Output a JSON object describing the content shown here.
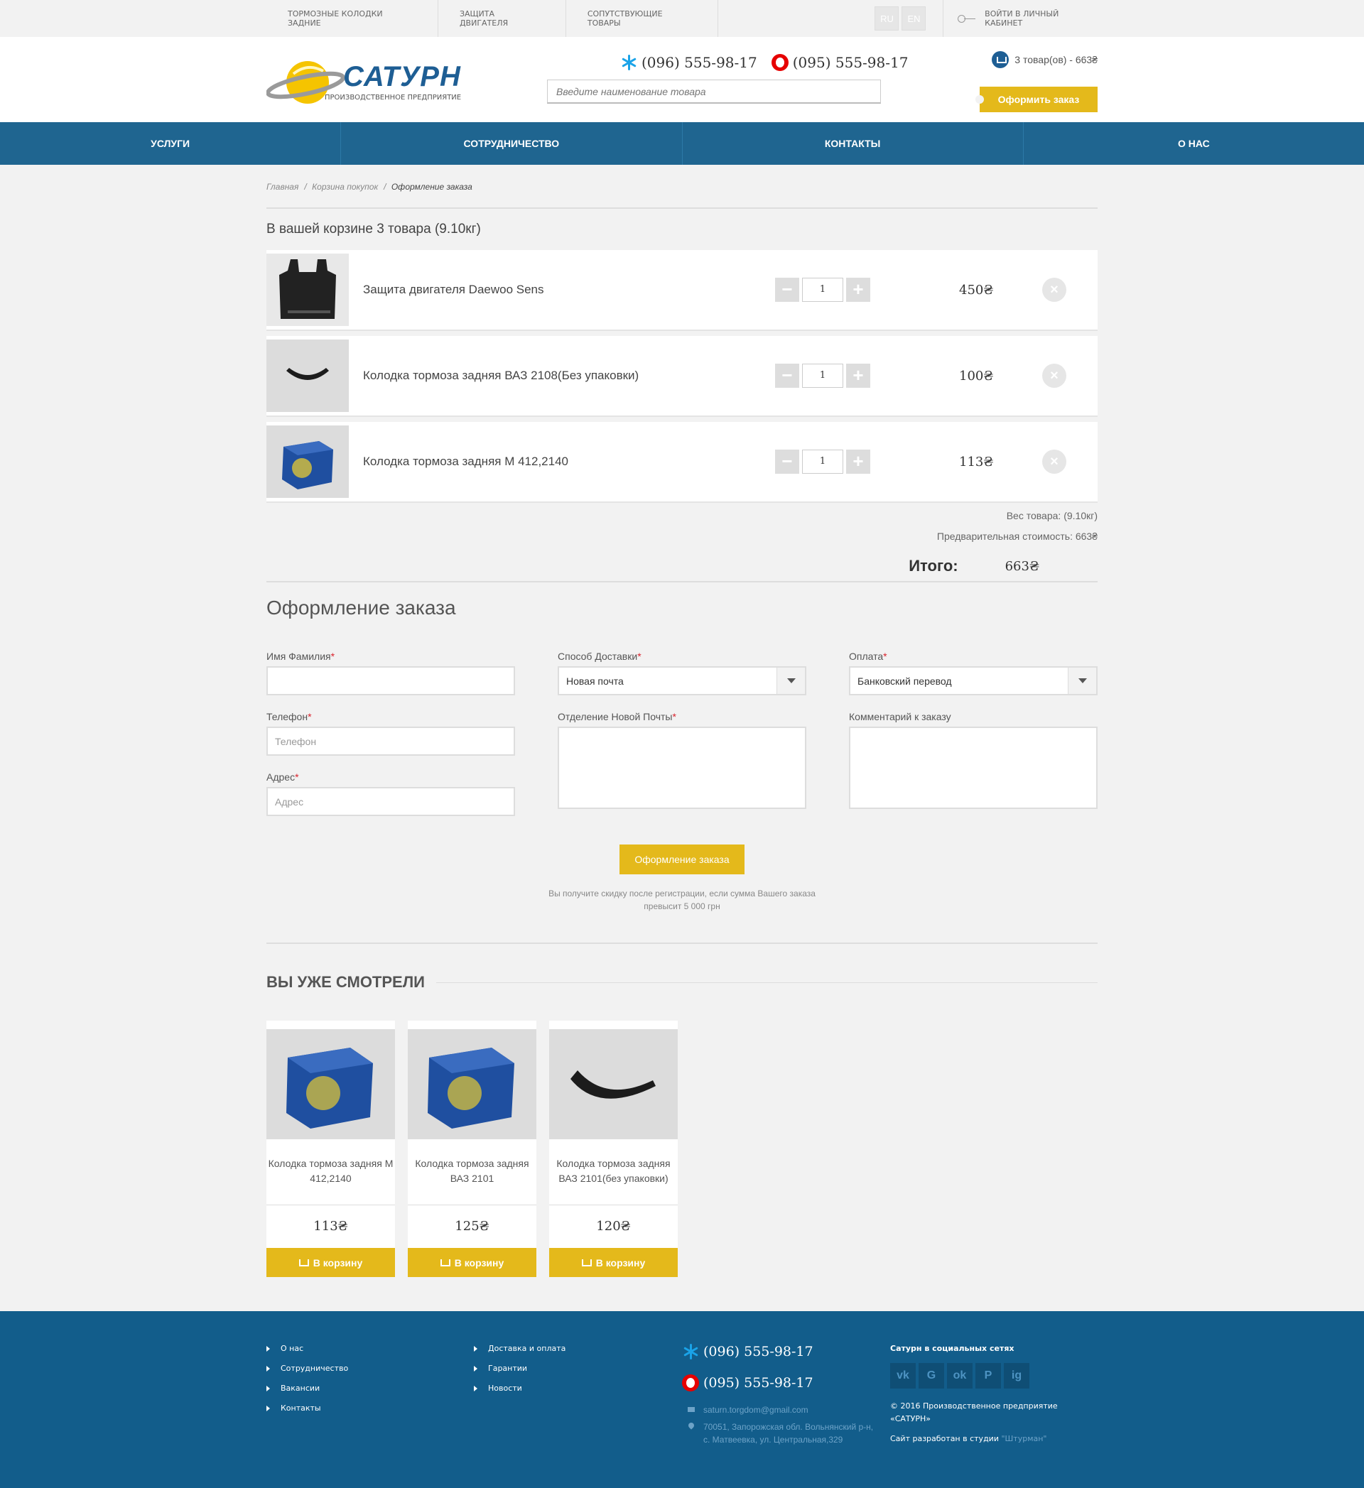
{
  "topbar": {
    "links": [
      "ТОРМОЗНЫЕ КОЛОДКИ ЗАДНИЕ",
      "ЗАЩИТА ДВИГАТЕЛЯ",
      "СОПУТСТВУЮЩИЕ ТОВАРЫ"
    ],
    "lang_ru": "RU",
    "lang_en": "EN",
    "login": "ВОЙТИ В ЛИЧНЫЙ КАБИНЕТ"
  },
  "header": {
    "logo_title": "САТУРН",
    "logo_subtitle": "ПРОИЗВОДСТВЕННОЕ ПРЕДПРИЯТИЕ",
    "phone1": "(096) 555-98-17",
    "phone2": "(095) 555-98-17",
    "search_placeholder": "Введите наименование товара",
    "cart_summary": "3 товар(ов) - 663₴",
    "checkout_label": "Оформить заказ"
  },
  "nav": [
    "УСЛУГИ",
    "СОТРУДНИЧЕСТВО",
    "КОНТАКТЫ",
    "О НАС"
  ],
  "breadcrumb": {
    "home": "Главная",
    "cart": "Корзина покупок",
    "current": "Оформление заказа",
    "sep": "/"
  },
  "cart": {
    "title": "В вашей корзине 3 товара  (9.10кг)",
    "items": [
      {
        "name": "Защита двигателя Daewoo Sens",
        "qty": "1",
        "price": "450₴"
      },
      {
        "name": "Колодка тормоза задняя ВАЗ 2108(Без упаковки)",
        "qty": "1",
        "price": "100₴"
      },
      {
        "name": "Колодка тормоза задняя М 412,2140",
        "qty": "1",
        "price": "113₴"
      }
    ],
    "weight": "Вес товара:  (9.10кг)",
    "subtotal": "Предварительная стоимость: 663₴",
    "total_label": "Итого:",
    "total_value": "663₴",
    "minus": "−",
    "plus": "+",
    "remove": "×"
  },
  "order": {
    "title": "Оформление заказа",
    "name_label": "Имя Фамилия",
    "phone_label": "Телефон",
    "phone_placeholder": "Телефон",
    "address_label": "Адрес",
    "address_placeholder": "Адрес",
    "delivery_label": "Способ Доставки",
    "delivery_value": "Новая почта",
    "branch_label": "Отделение Новой Почты",
    "payment_label": "Оплата",
    "payment_value": "Банковский перевод",
    "comment_label": "Комментарий к заказу",
    "required_mark": "*",
    "submit_label": "Оформление заказа",
    "note_line1": "Вы получите скидку после регистрации, если сумма Вашего заказа",
    "note_line2": "превысит 5 000 грн"
  },
  "viewed": {
    "title": "ВЫ УЖЕ СМОТРЕЛИ",
    "buy_label": "В корзину",
    "products": [
      {
        "name": "Колодка тормоза задняя М 412,2140",
        "price": "113₴"
      },
      {
        "name": "Колодка тормоза задняя ВАЗ 2101",
        "price": "125₴"
      },
      {
        "name": "Колодка тормоза задняя ВАЗ 2101(без упаковки)",
        "price": "120₴"
      }
    ]
  },
  "footer": {
    "col1": [
      "О нас",
      "Сотрудничество",
      "Вакансии",
      "Контакты"
    ],
    "col2": [
      "Доставка и оплата",
      "Гарантии",
      "Новости"
    ],
    "phone1": "(096) 555-98-17",
    "phone2": "(095) 555-98-17",
    "email": "saturn.torgdom@gmail.com",
    "address": "70051, Запорожская обл. Вольнянский р-н, с. Матвеевка, ул. Центральная,329",
    "social_title": "Сатурн в социальных сетях",
    "social": [
      "vk",
      "G",
      "ok",
      "P",
      "ig"
    ],
    "copyright": "© 2016 Производственное предприятие «САТУРН»",
    "dev_text": "Сайт разработан в студии",
    "dev_link": "\"Штурман\""
  },
  "colors": {
    "brand_blue": "#1f6590",
    "accent_yellow": "#e4b91b",
    "footer_blue": "#125d8b"
  }
}
